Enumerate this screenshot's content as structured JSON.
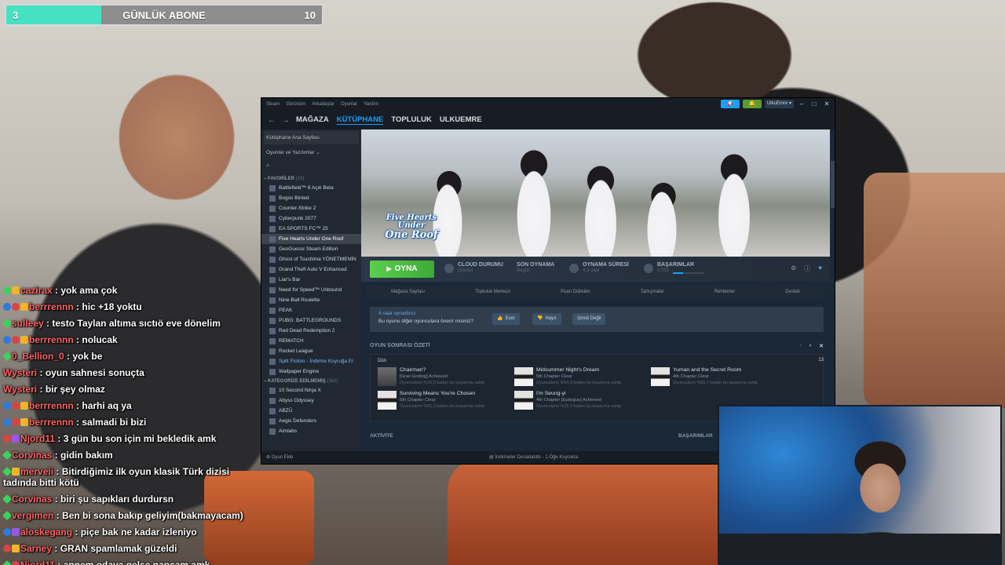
{
  "goal": {
    "current": "3",
    "title": "GÜNLÜK ABONE",
    "target": "10",
    "progress_fraction": 0.3
  },
  "chat": [
    {
      "name": "cazirax",
      "msg": ": yok ama çok",
      "badges": [
        "green",
        "gold"
      ]
    },
    {
      "name": "berrrennn",
      "msg": ": hic +18 yoktu",
      "badges": [
        "blue",
        "red",
        "gold"
      ]
    },
    {
      "name": "sulleey",
      "msg": ": testo Taylan altıma sıctıö eve dönelim",
      "badges": [
        "green"
      ]
    },
    {
      "name": "berrrennn",
      "msg": ": nolucak",
      "badges": [
        "blue",
        "red",
        "gold"
      ]
    },
    {
      "name": "0_Bellion_0",
      "msg": ": yok be",
      "badges": [
        "green"
      ]
    },
    {
      "name": "Wysteri",
      "msg": ": oyun sahnesi sonuçta",
      "badges": []
    },
    {
      "name": "Wysteri",
      "msg": ": bir şey olmaz",
      "badges": []
    },
    {
      "name": "berrrennn",
      "msg": ": harhi aq ya",
      "badges": [
        "blue",
        "red",
        "gold"
      ]
    },
    {
      "name": "berrrennn",
      "msg": ": salmadi bi bizi",
      "badges": [
        "blue",
        "red",
        "gold"
      ]
    },
    {
      "name": "Njord11",
      "msg": ": 3 gün bu son için mi bekledik amk",
      "badges": [
        "red",
        "purple"
      ]
    },
    {
      "name": "Corvinas",
      "msg": ": gidin bakım",
      "badges": [
        "green"
      ]
    },
    {
      "name": "merveii",
      "msg": ": Bitirdiğimiz ilk oyun klasik Türk dizisi tadında bitti kötü",
      "badges": [
        "green",
        "gold"
      ]
    },
    {
      "name": "Corvinas",
      "msg": ": biri şu sapıkları durdursn",
      "badges": [
        "green"
      ]
    },
    {
      "name": "vergimen",
      "msg": ": Ben bi sona bakıp geliyim(bakmayacam)",
      "badges": [
        "green"
      ]
    },
    {
      "name": "aloskegang",
      "msg": ": piçe bak ne kadar izleniyo",
      "badges": [
        "blue",
        "purple"
      ]
    },
    {
      "name": "Sarney",
      "msg": ": GRAN spamlamak güzeldi",
      "badges": [
        "red",
        "gold"
      ]
    },
    {
      "name": "Njord11",
      "msg": ": annem odaya gelse napcam amk",
      "badges": [
        "green",
        "red"
      ]
    }
  ],
  "steam": {
    "menu": [
      "Steam",
      "Görünüm",
      "Arkadaşlar",
      "Oyunlar",
      "Yardım"
    ],
    "user": "UlkuEmre",
    "nav_tabs": [
      "MAĞAZA",
      "KÜTÜPHANE",
      "TOPLULUK",
      "ULKUEMRE"
    ],
    "active_tab": "KÜTÜPHANE",
    "home_label": "Kütüphane Ana Sayfası",
    "filter_label": "Oyunlar ve Yazılımlar",
    "favorites_label": "FAVORİLER",
    "favorites_count": "(19)",
    "games": [
      "Battlefield™ 6 Açık Beta",
      "Bogos Binted",
      "Counter-Strike 2",
      "Cyberpunk 2077",
      "EA SPORTS FC™ 25",
      "Five Hearts Under One Roof",
      "GeoGuessr Steam Edition",
      "Ghost of Tsushima YÖNETMENİN",
      "Grand Theft Auto V Enhanced",
      "Liar's Bar",
      "Need for Speed™ Unbound",
      "Nine-Ball Roulette",
      "PEAK",
      "PUBG: BATTLEGROUNDS",
      "Red Dead Redemption 2",
      "REMATCH",
      "Rocket League",
      "Split Fiction - İndirme Kuyruğa El",
      "Wallpaper Engine"
    ],
    "selected_game": "Five Hearts Under One Roof",
    "uncategorized_label": "KATEGORİZE EDİLMEMİŞ",
    "uncategorized_count": "(362)",
    "uncategorized": [
      "10 Second Ninja X",
      "Abyss Odyssey",
      "ABZÛ",
      "Aegis Defenders",
      "Aimlabs"
    ],
    "hero_logo": {
      "line1": "Five Hearts",
      "line2": "Under",
      "line3": "One Roof"
    },
    "play_label": "OYNA",
    "stats": [
      {
        "label": "CLOUD DURUMU",
        "value": "Güncel"
      },
      {
        "label": "SON OYNAMA",
        "value": "Bugün"
      },
      {
        "label": "OYNAMA SÜRESİ",
        "value": "4,3 saat"
      },
      {
        "label": "BAŞARIMLAR",
        "value": "17/53"
      }
    ],
    "achievement_fraction": 0.32,
    "subnav": [
      "Mağaza Sayfası",
      "Topluluk Merkezi",
      "Puan Dükkânı",
      "Tartışmalar",
      "Rehberler",
      "Destek"
    ],
    "recommend": {
      "played": "4 saat oynadınız",
      "question": "Bu oyunu diğer oyunculara önerir misiniz?",
      "yes": "Evet",
      "no": "Hayır",
      "later": "Şimdi Değil"
    },
    "recap_title": "OYUN SONRASI ÖZETİ",
    "recap_day": "Dün",
    "recap_count": "13",
    "achievements": [
      {
        "name": "Chairman?",
        "desc": "[Gran Ending] Achieved",
        "pct": "Oyuncuların %30,5 kadarı bu başarıma sahip"
      },
      {
        "name": "Midsummer Night's Dream",
        "desc": "5th Chapter Clear",
        "pct": "Oyuncuların %54,9 kadarı bu başarıma sahip"
      },
      {
        "name": "Yuman and the Secret Room",
        "desc": "4th Chapter Clear",
        "pct": "Oyuncuların %65,7 kadarı bu başarıma sahip"
      },
      {
        "name": "Surviving Means You're Chosen",
        "desc": "6th Chapter Clear",
        "pct": "Oyuncuların %51,3 kadarı bu başarıma sahip"
      },
      {
        "name": "I'm Seung-yi",
        "desc": "4th Chapter [Epilogue] Achieved",
        "pct": "Oyuncuların %28,2 kadarı bu başarıma sahip"
      }
    ],
    "activity_label": "AKTİVİTE",
    "achievements_label": "BAŞARIMLAR",
    "add_game": "Oyun Ekle",
    "downloads": "İndirmeler Duraklatıldı - 1 Öğe Kuyrukta"
  }
}
